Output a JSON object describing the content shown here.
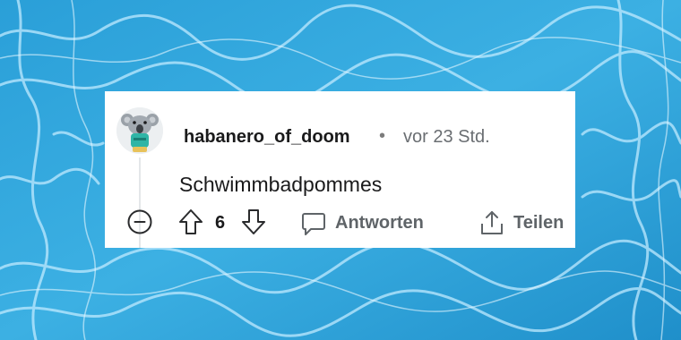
{
  "comment": {
    "username": "habanero_of_doom",
    "separator": "•",
    "timestamp": "vor 23 Std.",
    "body": "Schwimmbadpommes",
    "score": "6",
    "reply_label": "Antworten",
    "share_label": "Teilen"
  },
  "icons": {
    "collapse": "minus-circle-icon",
    "upvote": "arrow-up-icon",
    "downvote": "arrow-down-icon",
    "reply": "speech-bubble-icon",
    "share": "share-icon"
  },
  "colors": {
    "background_water": "#3aa8dc",
    "card": "#ffffff",
    "text_primary": "#1a1a1b",
    "text_secondary": "#6a6e72",
    "action_text": "#5f6468",
    "avatar_koala": "#9aa1a8",
    "avatar_shirt": "#2fb5a6"
  }
}
